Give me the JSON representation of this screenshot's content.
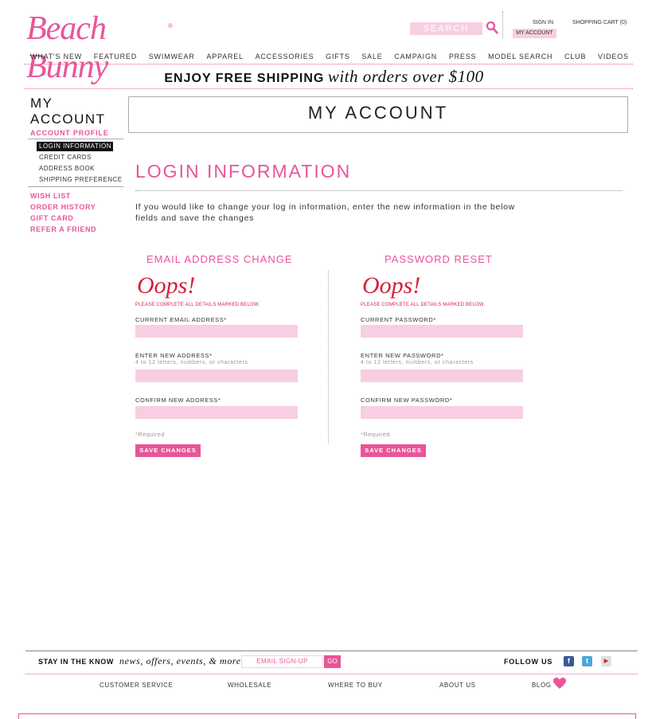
{
  "brand": {
    "logo_text": "Beach Bunny",
    "reg_mark": "®",
    "accent": "#e8559a",
    "field_bg": "#f8cfe2",
    "error": "#d81f3c"
  },
  "header": {
    "search_placeholder": "SEARCH",
    "sign_in": "SIGN IN",
    "my_account": "MY ACCOUNT",
    "cart": "SHOPPING CART (0)"
  },
  "nav": [
    "WHAT'S NEW",
    "FEATURED",
    "SWIMWEAR",
    "APPAREL",
    "ACCESSORIES",
    "GIFTS",
    "SALE",
    "CAMPAIGN",
    "PRESS",
    "MODEL SEARCH",
    "CLUB",
    "VIDEOS"
  ],
  "promo": {
    "bold": "ENJOY FREE SHIPPING",
    "italic": "with orders over $100"
  },
  "sidebar": {
    "title_line1": "MY",
    "title_line2": "ACCOUNT",
    "section": "ACCOUNT PROFILE",
    "active_item": "LOGIN INFORMATION",
    "items": [
      "CREDIT CARDS",
      "ADDRESS BOOK",
      "SHIPPING PREFERENCE"
    ],
    "links": [
      "WISH LIST",
      "ORDER HISTORY",
      "GIFT CARD",
      "REFER A FRIEND"
    ]
  },
  "main": {
    "banner": "MY ACCOUNT",
    "heading": "LOGIN INFORMATION",
    "intro": "If you would like to change your log in information, enter the new information in the below fields and save the changes"
  },
  "email_form": {
    "heading": "EMAIL ADDRESS CHANGE",
    "oops": "Oops!",
    "warning": "PLEASE COMPLETE ALL DETAILS MARKED BELOW.",
    "current_label": "CURRENT EMAIL ADDRESS*",
    "new_label": "ENTER NEW ADDRESS*",
    "new_hint": "4 to 12 letters, numbers, or characters",
    "confirm_label": "CONFIRM NEW ADDRESS*",
    "required": "*Required",
    "save": "SAVE CHANGES"
  },
  "password_form": {
    "heading": "PASSWORD RESET",
    "oops": "Oops!",
    "warning": "PLEASE COMPLETE ALL DETAILS MARKED BELOW.",
    "current_label": "CURRENT PASSWORD*",
    "new_label": "ENTER NEW PASSWORD*",
    "new_hint": "4 to 12 letters, numbers, or characters",
    "confirm_label": "CONFIRM NEW PASSWORD*",
    "required": "*Required",
    "save": "SAVE CHANGES"
  },
  "footer": {
    "stay_bold": "STAY IN THE KNOW",
    "stay_italic": "news, offers, events, & more",
    "email_placeholder": "EMAIL SIGN-UP",
    "go": "GO",
    "follow": "FOLLOW US",
    "links": [
      "CUSTOMER SERVICE",
      "WHOLESALE",
      "WHERE TO BUY",
      "ABOUT US",
      "BLOG"
    ],
    "icons": [
      "facebook-icon",
      "twitter-icon",
      "youtube-icon"
    ]
  }
}
